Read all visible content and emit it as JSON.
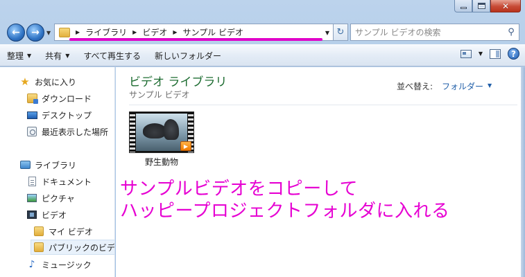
{
  "window": {
    "minimize_label": "—",
    "maximize_label": "□",
    "close_label": "✕"
  },
  "nav": {
    "back_icon": "arrow-left-icon",
    "forward_icon": "arrow-right-icon",
    "back_glyph": "←",
    "forward_glyph": "→",
    "breadcrumbs": [
      "ライブラリ",
      "ビデオ",
      "サンプル ビデオ"
    ],
    "refresh_glyph": "↻"
  },
  "search": {
    "placeholder": "サンプル ビデオの検索",
    "icon": "search-icon",
    "glyph": "⚲"
  },
  "commandbar": {
    "organize": "整理",
    "share": "共有",
    "play_all": "すべて再生する",
    "new_folder": "新しいフォルダー"
  },
  "sidebar": {
    "items": [
      {
        "label": "お気に入り",
        "icon": "star-icon"
      },
      {
        "label": "ダウンロード",
        "icon": "download-folder-icon"
      },
      {
        "label": "デスクトップ",
        "icon": "desktop-icon"
      },
      {
        "label": "最近表示した場所",
        "icon": "recent-places-icon"
      },
      {
        "label": "ライブラリ",
        "icon": "library-icon"
      },
      {
        "label": "ドキュメント",
        "icon": "document-icon"
      },
      {
        "label": "ピクチャ",
        "icon": "picture-icon"
      },
      {
        "label": "ビデオ",
        "icon": "video-icon"
      },
      {
        "label": "マイ ビデオ",
        "icon": "folder-icon"
      },
      {
        "label": "パブリックのビデ",
        "icon": "folder-icon"
      },
      {
        "label": "ミュージック",
        "icon": "music-icon"
      }
    ]
  },
  "main": {
    "title": "ビデオ ライブラリ",
    "subtitle": "サンプル ビデオ",
    "sort_label": "並べ替え:",
    "sort_value": "フォルダー",
    "file": {
      "name": "野生動物",
      "icon": "video-thumbnail"
    }
  },
  "annotation": {
    "line1": "サンプルビデオをコピーして",
    "line2": "ハッピープロジェクトフォルダに入れる",
    "color": "#e600d2"
  },
  "colors": {
    "accent": "#1f5ea8",
    "title_green": "#1d6c31",
    "annotation_magenta": "#e600d2"
  }
}
